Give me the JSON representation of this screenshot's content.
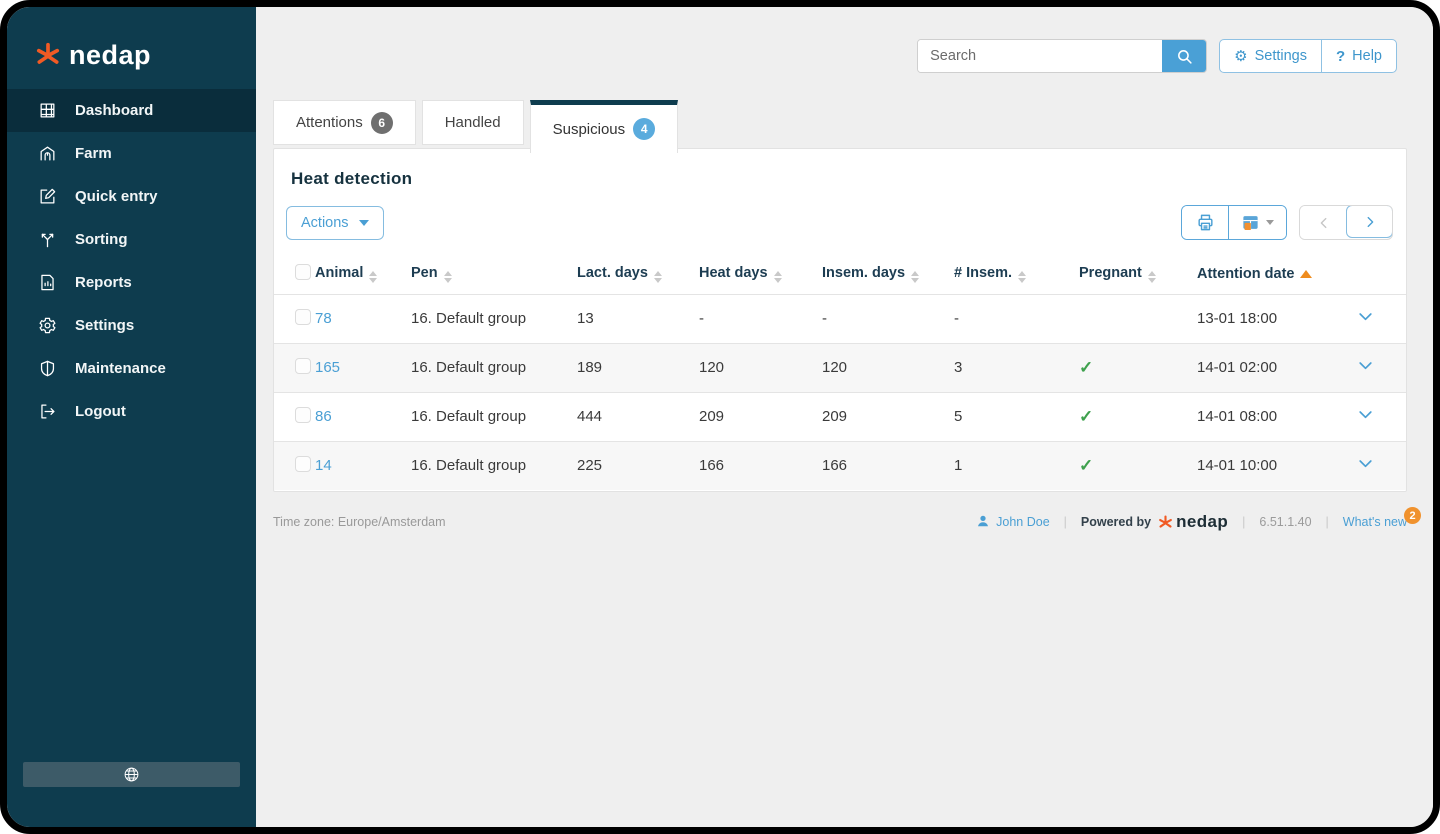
{
  "colors": {
    "sidebar_bg": "#0e3c4e",
    "accent_blue": "#4aa0d6",
    "brand_orange": "#f15a24",
    "success_green": "#3fa14e",
    "sort_orange": "#ef8c1e"
  },
  "brand": {
    "name": "nedap",
    "logo_icon": "nedap-star-icon"
  },
  "sidebar": {
    "items": [
      {
        "label": "Dashboard",
        "icon": "grid-icon",
        "active": true
      },
      {
        "label": "Farm",
        "icon": "barn-icon",
        "active": false
      },
      {
        "label": "Quick entry",
        "icon": "pencil-square-icon",
        "active": false
      },
      {
        "label": "Sorting",
        "icon": "fork-arrows-icon",
        "active": false
      },
      {
        "label": "Reports",
        "icon": "document-chart-icon",
        "active": false
      },
      {
        "label": "Settings",
        "icon": "gear-icon",
        "active": false
      },
      {
        "label": "Maintenance",
        "icon": "shield-icon",
        "active": false
      },
      {
        "label": "Logout",
        "icon": "logout-icon",
        "active": false
      }
    ],
    "language_icon": "globe-icon"
  },
  "header": {
    "search": {
      "placeholder": "Search",
      "icon": "search-icon"
    },
    "settings_label": "Settings",
    "settings_glyph": "⚙",
    "help_label": "Help",
    "help_glyph": "?"
  },
  "tabs": [
    {
      "label": "Attentions",
      "badge": "6",
      "active": false
    },
    {
      "label": "Handled",
      "badge": null,
      "active": false
    },
    {
      "label": "Suspicious",
      "badge": "4",
      "active": true
    }
  ],
  "panel": {
    "title": "Heat detection",
    "actions_label": "Actions"
  },
  "table": {
    "columns": [
      {
        "label": "Animal",
        "sortable": true,
        "sorted": null
      },
      {
        "label": "Pen",
        "sortable": true,
        "sorted": null
      },
      {
        "label": "Lact. days",
        "sortable": true,
        "sorted": null
      },
      {
        "label": "Heat days",
        "sortable": true,
        "sorted": null
      },
      {
        "label": "Insem. days",
        "sortable": true,
        "sorted": null
      },
      {
        "label": "# Insem.",
        "sortable": true,
        "sorted": null
      },
      {
        "label": "Pregnant",
        "sortable": true,
        "sorted": null
      },
      {
        "label": "Attention date",
        "sortable": true,
        "sorted": "asc"
      }
    ],
    "rows": [
      {
        "animal": "78",
        "pen": "16. Default group",
        "lact_days": "13",
        "heat_days": "-",
        "insem_days": "-",
        "num_insem": "-",
        "pregnant": false,
        "attention_date": "13-01 18:00"
      },
      {
        "animal": "165",
        "pen": "16. Default group",
        "lact_days": "189",
        "heat_days": "120",
        "insem_days": "120",
        "num_insem": "3",
        "pregnant": true,
        "attention_date": "14-01 02:00"
      },
      {
        "animal": "86",
        "pen": "16. Default group",
        "lact_days": "444",
        "heat_days": "209",
        "insem_days": "209",
        "num_insem": "5",
        "pregnant": true,
        "attention_date": "14-01 08:00"
      },
      {
        "animal": "14",
        "pen": "16. Default group",
        "lact_days": "225",
        "heat_days": "166",
        "insem_days": "166",
        "num_insem": "1",
        "pregnant": true,
        "attention_date": "14-01 10:00"
      }
    ]
  },
  "icons": {
    "check": "✓"
  },
  "footer": {
    "timezone": "Time zone: Europe/Amsterdam",
    "user": "John Doe",
    "powered_by": "Powered by",
    "powered_brand": "nedap",
    "version": "6.51.1.40",
    "whats_new": "What's new",
    "whats_new_badge": "2"
  }
}
